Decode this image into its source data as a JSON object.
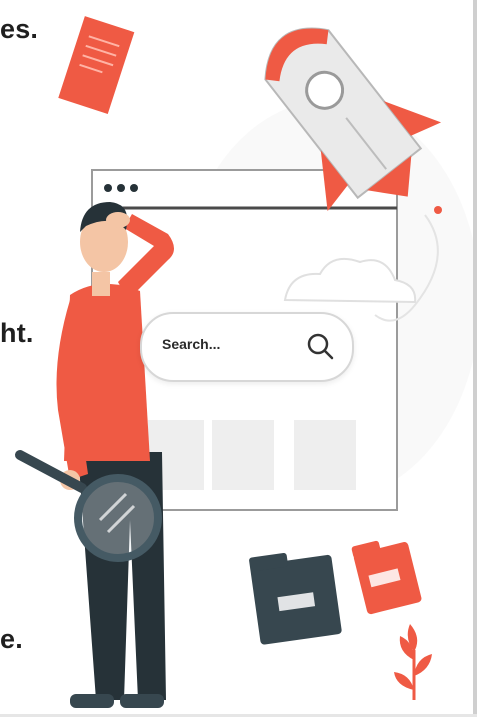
{
  "text_fragments": {
    "line1": "es.",
    "line2": "ht.",
    "line3": "e."
  },
  "search_box": {
    "placeholder_text": "Search...",
    "icon": "search-icon"
  },
  "colors": {
    "accent": "#ef5a44",
    "dark": "#263238",
    "light_gray": "#e9e9e9"
  }
}
